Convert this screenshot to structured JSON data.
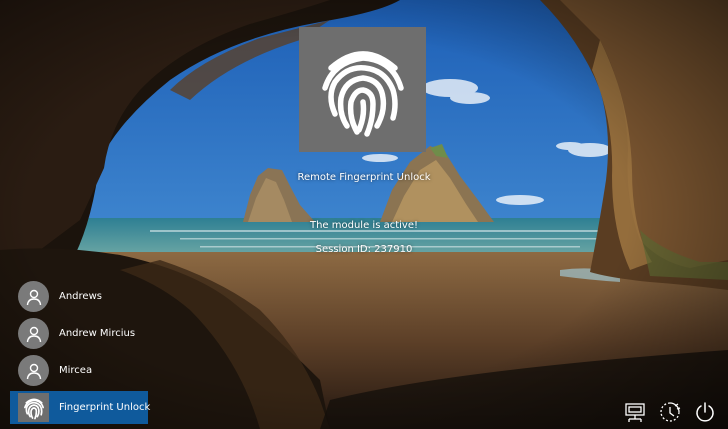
{
  "lock_screen": {
    "title": "Remote Fingerprint Unlock",
    "status": "The module is active!",
    "session": "Session ID: 237910"
  },
  "users": [
    {
      "name": "Andrews",
      "icon": "user-icon"
    },
    {
      "name": "Andrew Mircius",
      "icon": "user-icon"
    },
    {
      "name": "Mircea",
      "icon": "user-icon"
    },
    {
      "name": "Fingerprint Unlock",
      "icon": "fingerprint-icon",
      "selected": true
    }
  ],
  "system_buttons": [
    "network-icon",
    "ease-of-access-icon",
    "power-icon"
  ],
  "colors": {
    "selected_user": "#0f5a9c",
    "tile": "#6e6e6e",
    "avatar": "#7a7a7a",
    "text": "#ffffff"
  }
}
